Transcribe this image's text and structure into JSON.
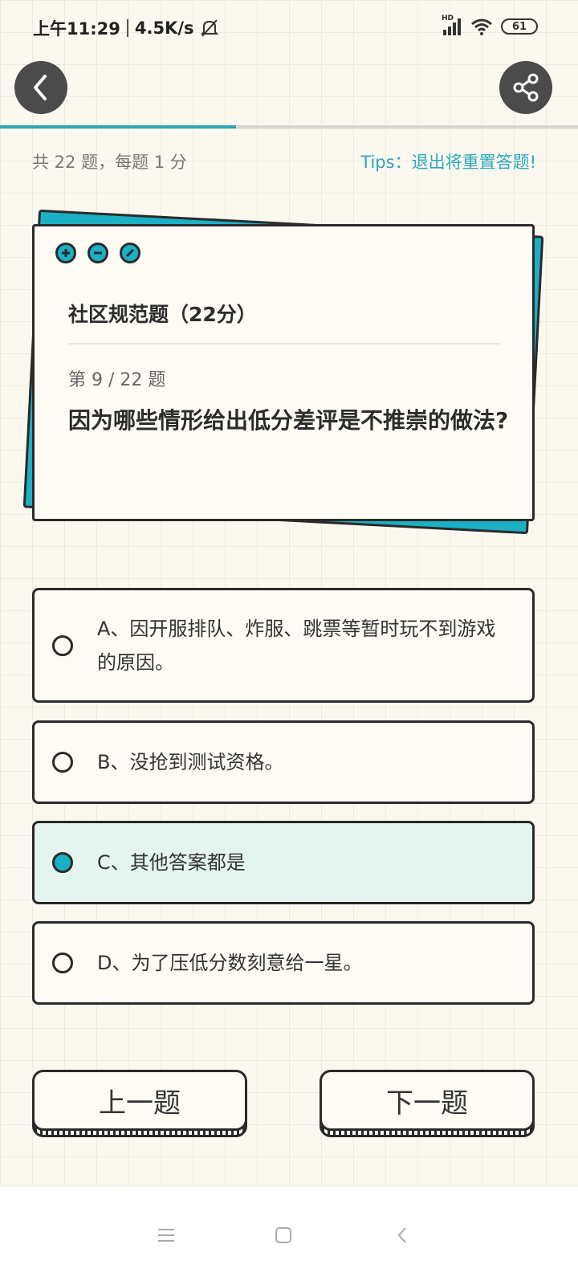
{
  "status_bar": {
    "time": "上午11:29",
    "speed": "4.5K/s",
    "network_label": "HD",
    "battery": "61"
  },
  "header": {
    "progress": 0.409
  },
  "quiz_info": {
    "summary": "共 22 题，每题 1 分",
    "tips": "Tips：退出将重置答题!"
  },
  "card": {
    "title": "社区规范题（22分）",
    "question_number": "第 9 / 22 题",
    "question": "因为哪些情形给出低分差评是不推崇的做法?"
  },
  "options": [
    {
      "text": "A、因开服排队、炸服、跳票等暂时玩不到游戏的原因。",
      "selected": false
    },
    {
      "text": "B、没抢到测试资格。",
      "selected": false
    },
    {
      "text": "C、其他答案都是",
      "selected": true
    },
    {
      "text": "D、为了压低分数刻意给一星。",
      "selected": false
    }
  ],
  "buttons": {
    "prev": "上一题",
    "next": "下一题"
  },
  "colors": {
    "accent": "#1bb0c4",
    "tips": "#2aa8bd",
    "selected_bg": "#e4f4ef"
  }
}
